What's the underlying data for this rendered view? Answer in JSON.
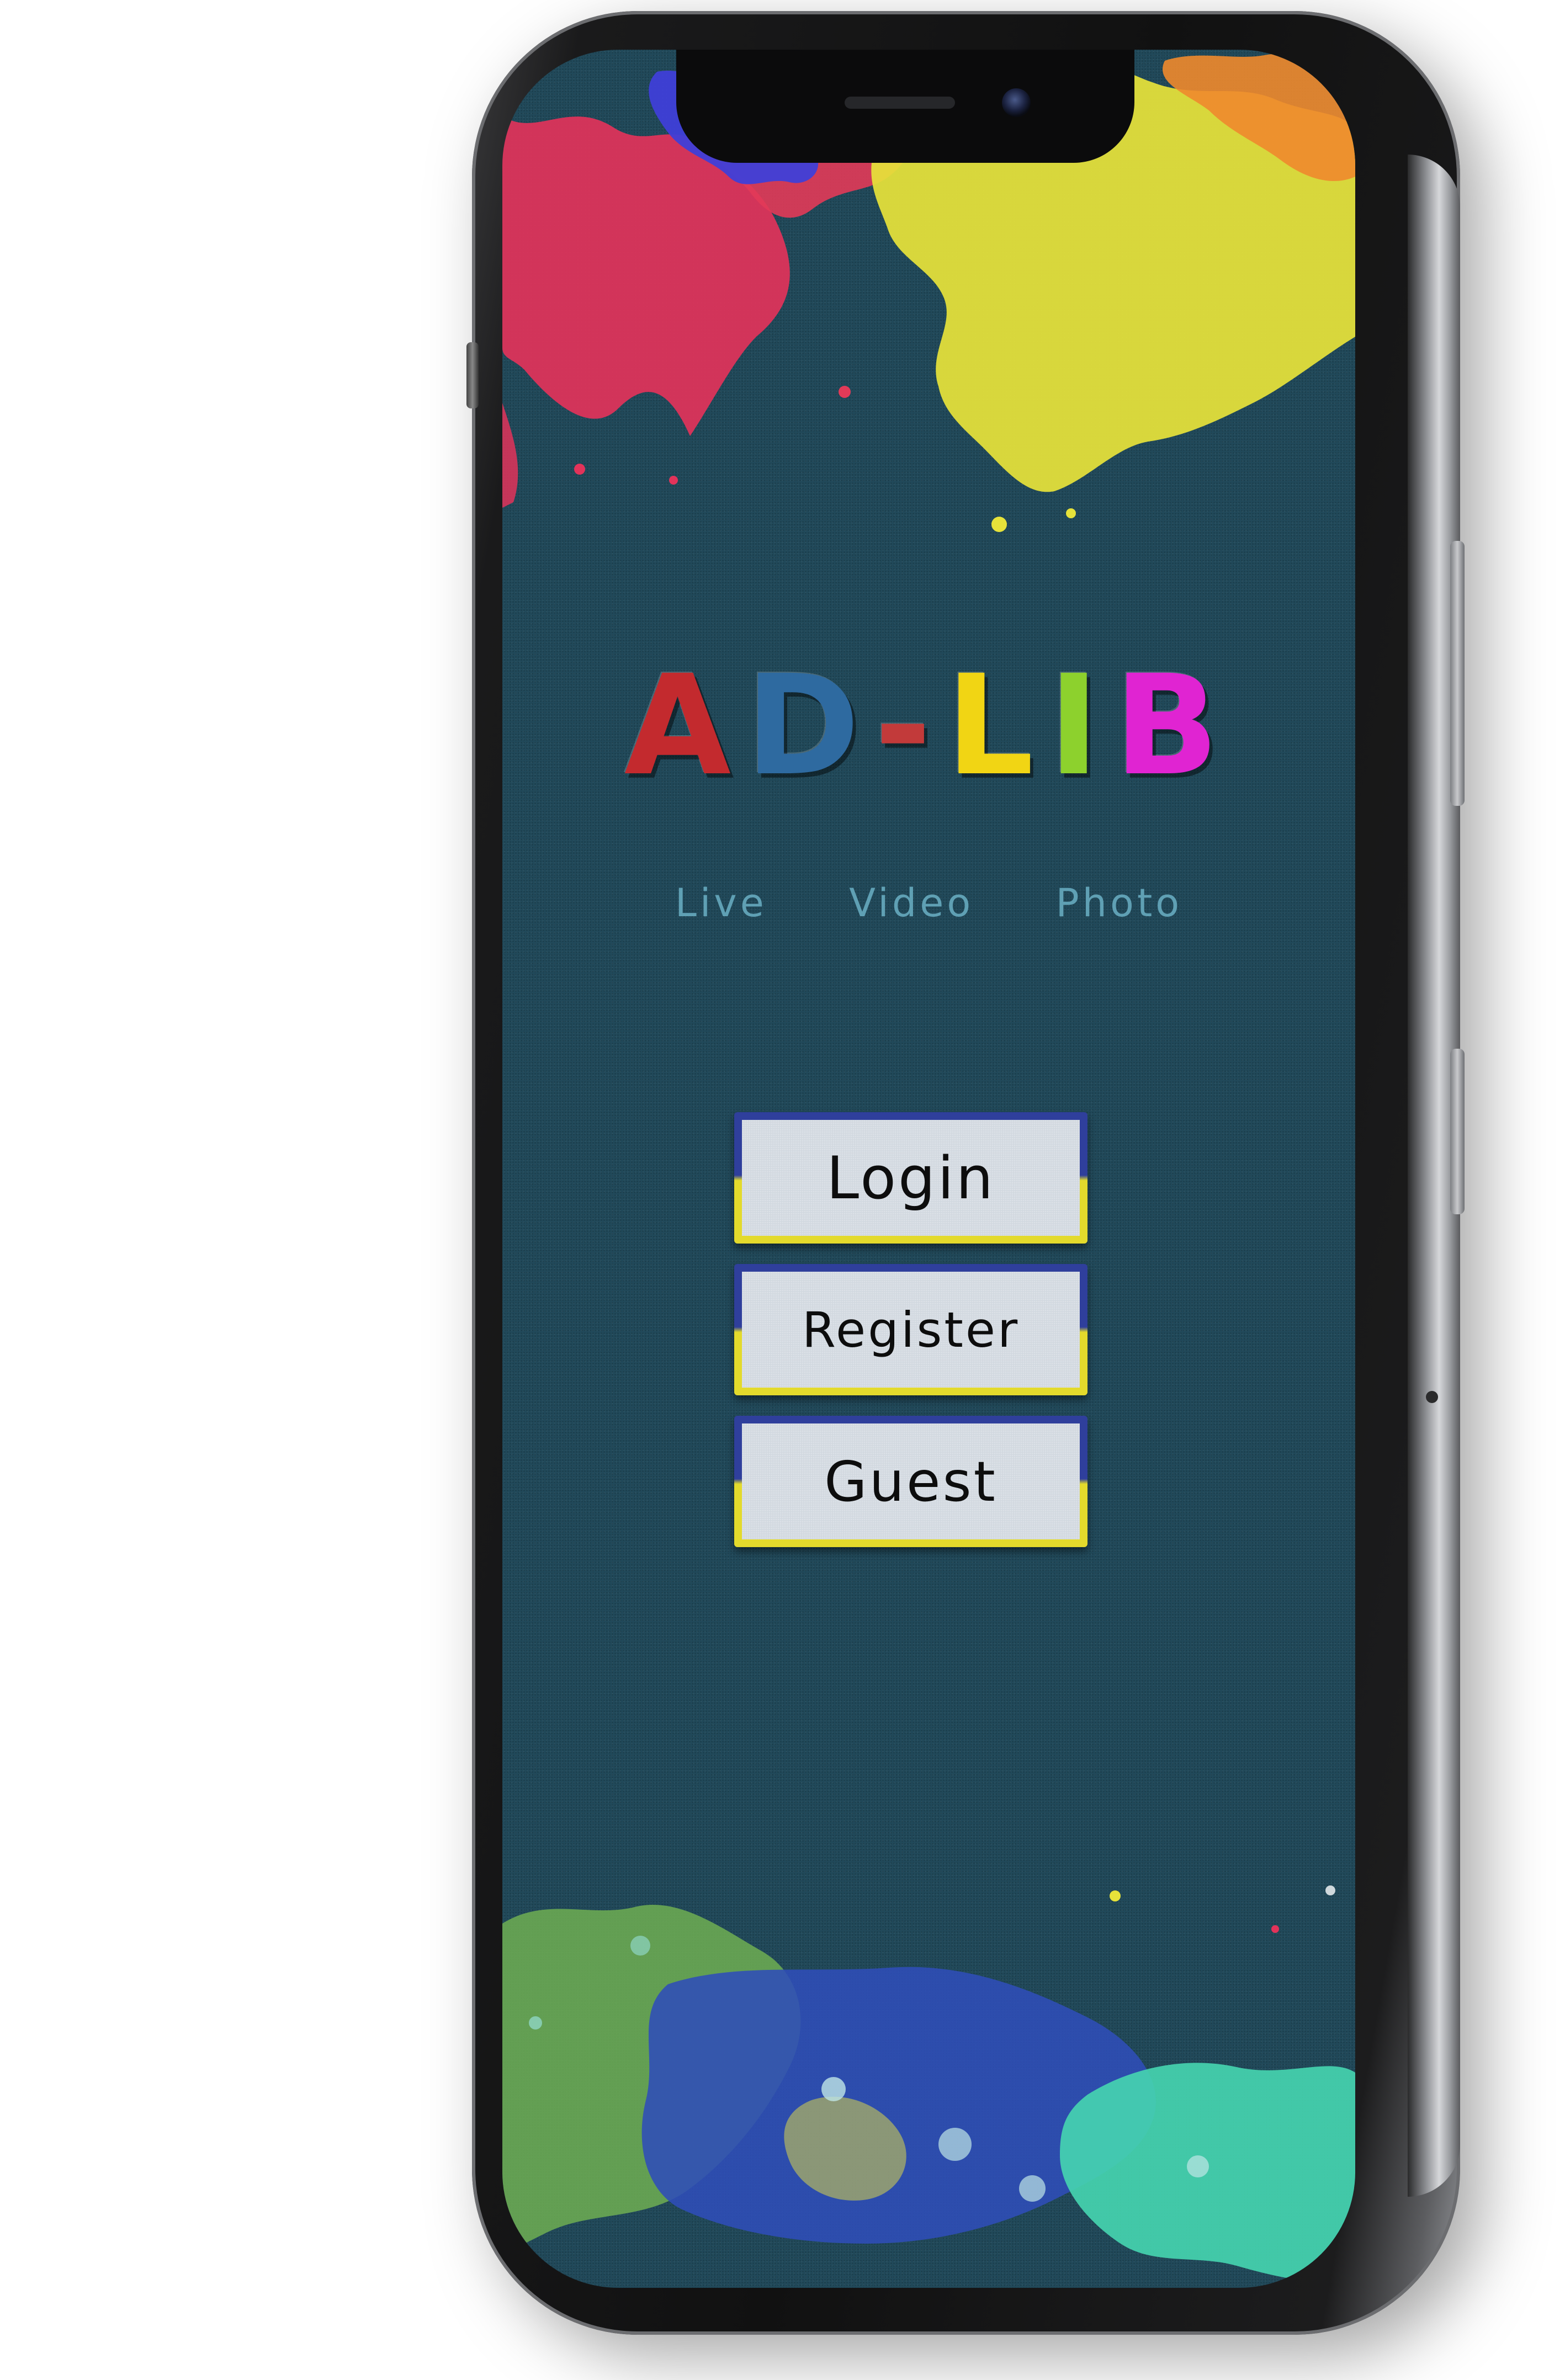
{
  "app": {
    "logo_letters": [
      {
        "char": "A",
        "color": "#c32a2e"
      },
      {
        "char": "D",
        "color": "#2e6aa0"
      },
      {
        "char": "-",
        "color": "#c23a3a"
      },
      {
        "char": "L",
        "color": "#f1d514"
      },
      {
        "char": "I",
        "color": "#8dd12d"
      },
      {
        "char": "B",
        "color": "#e024d2"
      }
    ]
  },
  "modes": {
    "live": "Live",
    "video": "Video",
    "photo": "Photo"
  },
  "buttons": {
    "login": "Login",
    "register": "Register",
    "guest": "Guest"
  },
  "colors": {
    "screen_background": "#21495a",
    "button_top_stripe": "#2f3f9c",
    "button_bottom_stripe": "#e3da2c",
    "button_face": "#d2d9e0",
    "mode_text": "#5fa0b4"
  }
}
